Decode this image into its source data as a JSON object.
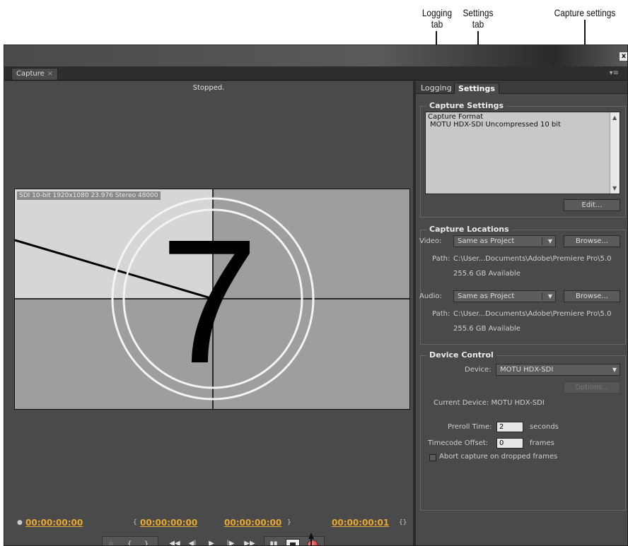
{
  "callouts": {
    "logging_tab": "Logging\ntab",
    "settings_tab": "Settings\ntab",
    "capture_settings": "Capture settings"
  },
  "window": {
    "close_label": "x",
    "panel_tab_label": "Capture",
    "panel_tab_close": "×",
    "panel_menu_icon": "▾≡"
  },
  "monitor": {
    "status": "Stopped.",
    "video_info": "SDI 10-bit 1920x1080 23.976 Stereo 48000",
    "countdown_number": "7"
  },
  "timecodes": {
    "current": "00:00:00:00",
    "in_point": "00:00:00:00",
    "out_point": "00:00:00:00",
    "duration": "00:00:00:01"
  },
  "tabs": {
    "logging": "Logging",
    "settings": "Settings"
  },
  "capture_settings": {
    "title": "Capture Settings",
    "format_label": "Capture Format",
    "format_value": "MOTU HDX-SDI Uncompressed 10 bit",
    "edit_button": "Edit..."
  },
  "capture_locations": {
    "title": "Capture Locations",
    "video_label": "Video:",
    "video_value": "Same as Project",
    "browse_button": "Browse...",
    "path_label": "Path:",
    "video_path": "C:\\User...Documents\\Adobe\\Premiere Pro\\5.0",
    "video_available": "255.6 GB Available",
    "audio_label": "Audio:",
    "audio_value": "Same as Project",
    "audio_path": "C:\\User...Documents\\Adobe\\Premiere Pro\\5.0",
    "audio_available": "255.6 GB Available"
  },
  "device_control": {
    "title": "Device Control",
    "device_label": "Device:",
    "device_value": "MOTU HDX-SDI",
    "options_button": "Options...",
    "current_device": "Current Device:  MOTU HDX-SDI",
    "preroll_label": "Preroll Time:",
    "preroll_value": "2",
    "preroll_unit": "seconds",
    "tc_offset_label": "Timecode Offset:",
    "tc_offset_value": "0",
    "tc_offset_unit": "frames",
    "abort_label": "Abort capture on dropped frames",
    "abort_checked": false
  },
  "colors": {
    "timecode": "#e7a92f",
    "record": "#c01818"
  }
}
